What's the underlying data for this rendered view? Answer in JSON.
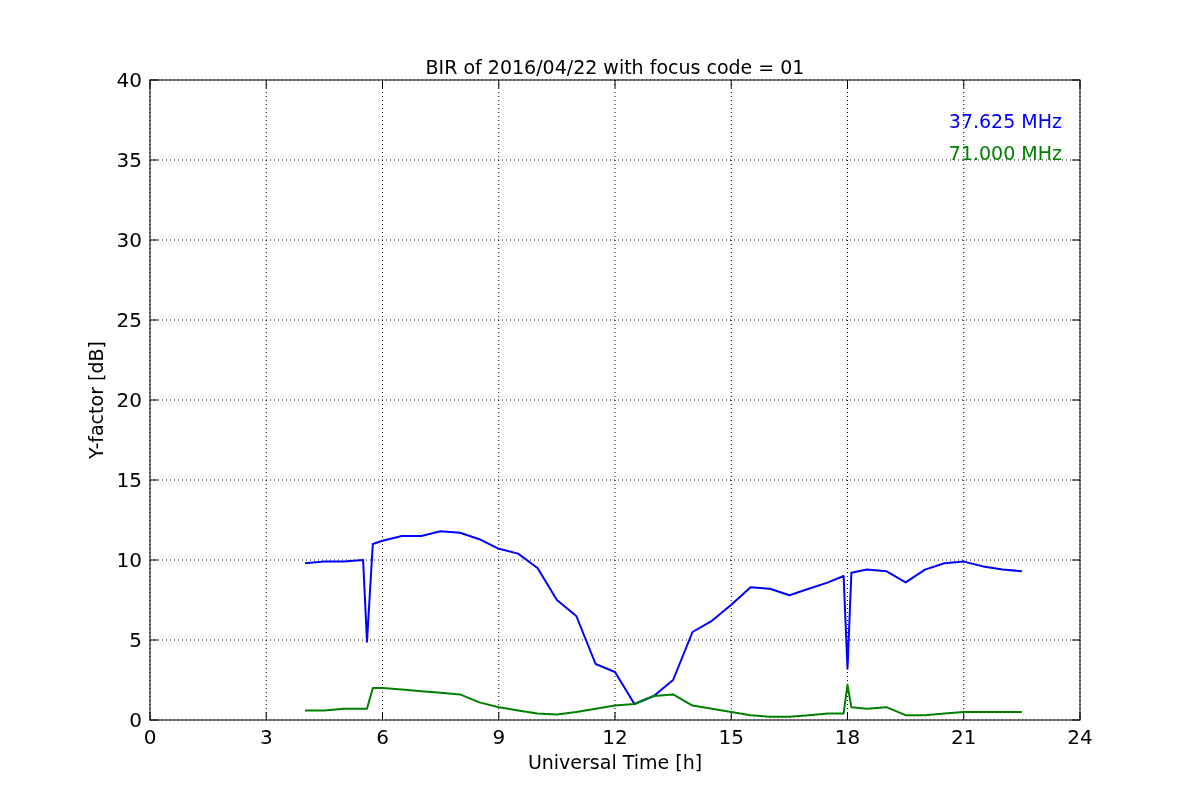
{
  "chart_data": {
    "type": "line",
    "title": "BIR of 2016/04/22 with focus code = 01",
    "xlabel": "Universal Time [h]",
    "ylabel": "Y-factor [dB]",
    "x": [
      4,
      4.5,
      5,
      5.5,
      5.6,
      5.75,
      6,
      6.5,
      7,
      7.5,
      8,
      8.5,
      9,
      9.5,
      10,
      10.5,
      11,
      11.5,
      12,
      12.5,
      13,
      13.5,
      14,
      14.5,
      15,
      15.5,
      16,
      16.5,
      17,
      17.5,
      17.9,
      18,
      18.1,
      18.5,
      19,
      19.5,
      20,
      20.5,
      21,
      21.5,
      22,
      22.5
    ],
    "series": [
      {
        "name": "37.625 MHz",
        "color": "#0000ff",
        "values": [
          9.8,
          9.9,
          9.9,
          10,
          4.9,
          11,
          11.2,
          11.5,
          11.5,
          11.8,
          11.7,
          11.3,
          10.7,
          10.4,
          9.5,
          7.5,
          6.5,
          3.5,
          3.0,
          1.0,
          1.5,
          2.5,
          5.5,
          6.2,
          7.2,
          8.3,
          8.2,
          7.8,
          8.2,
          8.6,
          9,
          3.2,
          9.2,
          9.4,
          9.3,
          8.6,
          9.4,
          9.8,
          9.9,
          9.6,
          9.4,
          9.3
        ]
      },
      {
        "name": "71.000 MHz",
        "color": "#008000",
        "values": [
          0.6,
          0.6,
          0.7,
          0.7,
          0.7,
          2.0,
          2.0,
          1.9,
          1.8,
          1.7,
          1.6,
          1.1,
          0.8,
          0.6,
          0.4,
          0.35,
          0.5,
          0.7,
          0.9,
          1.0,
          1.5,
          1.6,
          0.9,
          0.7,
          0.5,
          0.3,
          0.2,
          0.2,
          0.3,
          0.4,
          0.4,
          2.2,
          0.8,
          0.7,
          0.8,
          0.3,
          0.3,
          0.4,
          0.5,
          0.5,
          0.5,
          0.5
        ]
      }
    ],
    "xlim": [
      0,
      24
    ],
    "ylim": [
      0,
      40
    ],
    "xticks": [
      0,
      3,
      6,
      9,
      12,
      15,
      18,
      21,
      24
    ],
    "yticks": [
      0,
      5,
      10,
      15,
      20,
      25,
      30,
      35,
      40
    ],
    "grid": true
  }
}
